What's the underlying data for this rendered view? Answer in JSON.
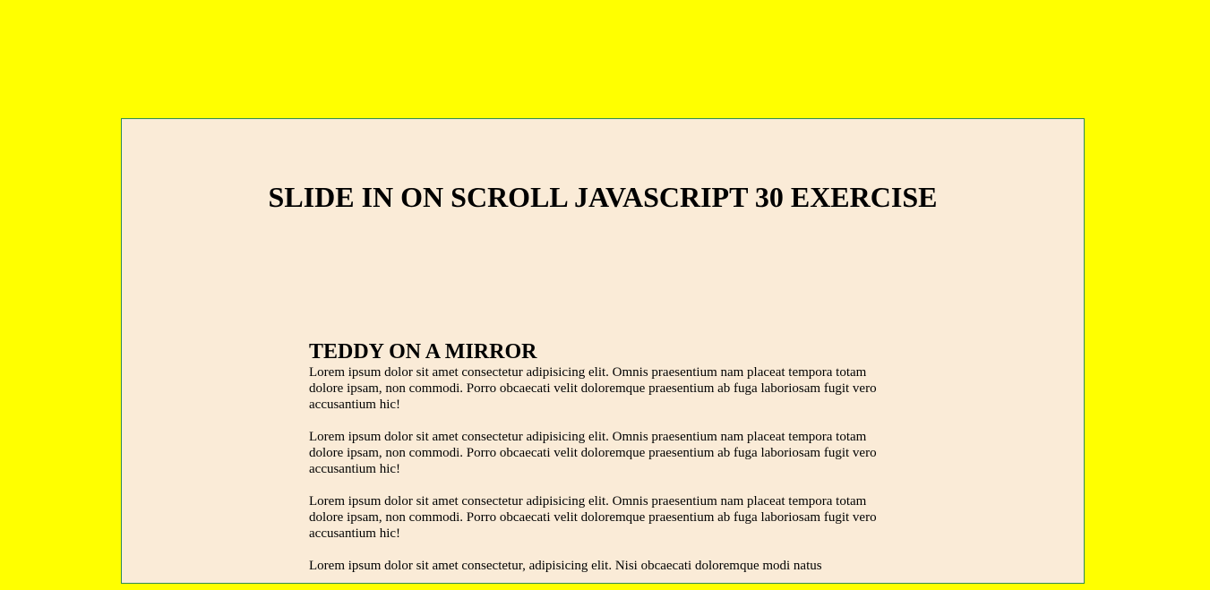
{
  "page": {
    "title": "SLIDE IN ON SCROLL JAVASCRIPT 30 EXERCISE"
  },
  "article": {
    "heading": "TEDDY ON A MIRROR",
    "paragraphs": [
      "Lorem ipsum dolor sit amet consectetur adipisicing elit. Omnis praesentium nam placeat tempora totam dolore ipsam, non commodi. Porro obcaecati velit doloremque praesentium ab fuga laboriosam fugit vero accusantium hic!",
      "Lorem ipsum dolor sit amet consectetur adipisicing elit. Omnis praesentium nam placeat tempora totam dolore ipsam, non commodi. Porro obcaecati velit doloremque praesentium ab fuga laboriosam fugit vero accusantium hic!",
      "Lorem ipsum dolor sit amet consectetur adipisicing elit. Omnis praesentium nam placeat tempora totam dolore ipsam, non commodi. Porro obcaecati velit doloremque praesentium ab fuga laboriosam fugit vero accusantium hic!",
      "Lorem ipsum dolor sit amet consectetur, adipisicing elit. Nisi obcaecati doloremque modi natus"
    ]
  },
  "colors": {
    "page_background": "#ffff00",
    "container_background": "#faebd7",
    "container_border": "#2e8b57"
  }
}
